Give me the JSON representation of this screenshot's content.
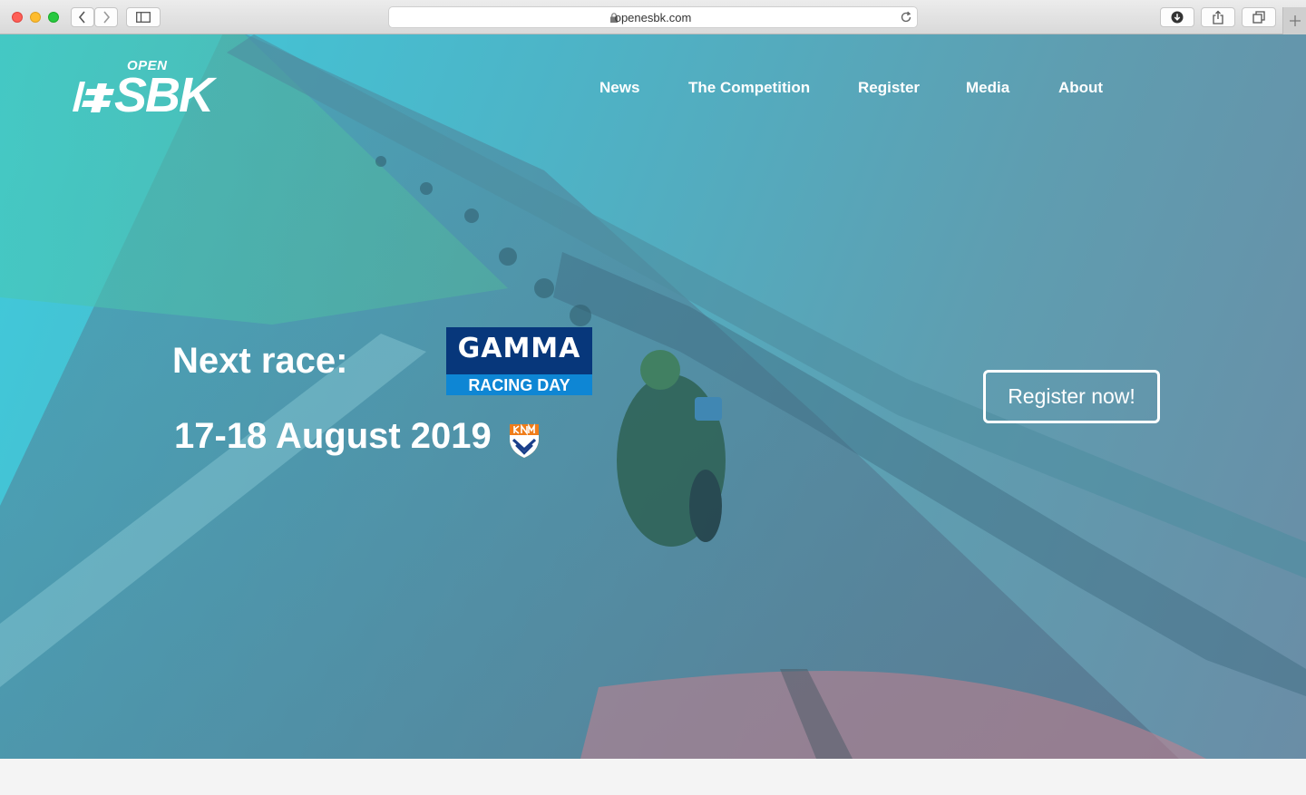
{
  "browser": {
    "url": "openesbk.com",
    "icons": [
      "back-icon",
      "forward-icon",
      "sidebar-icon",
      "lock-icon",
      "reload-icon",
      "download-icon",
      "share-icon",
      "tabs-icon",
      "new-tab-icon"
    ]
  },
  "logo": {
    "open": "OPEN",
    "name": "SBK"
  },
  "nav": {
    "items": [
      {
        "label": "News"
      },
      {
        "label": "The Competition"
      },
      {
        "label": "Register"
      },
      {
        "label": "Media"
      },
      {
        "label": "About"
      }
    ]
  },
  "hero": {
    "next_race_label": "Next race:",
    "date": "17-18 August 2019",
    "sponsor": {
      "brand": "Gamma",
      "event": "RACING DAY"
    },
    "organizer_badge": "KNMV",
    "cta": "Register now!"
  },
  "colors": {
    "overlay_left": "#3fcbdc",
    "overlay_right": "#6a8da6",
    "gamma_dark": "#07377b",
    "gamma_light": "#0e86d4"
  }
}
